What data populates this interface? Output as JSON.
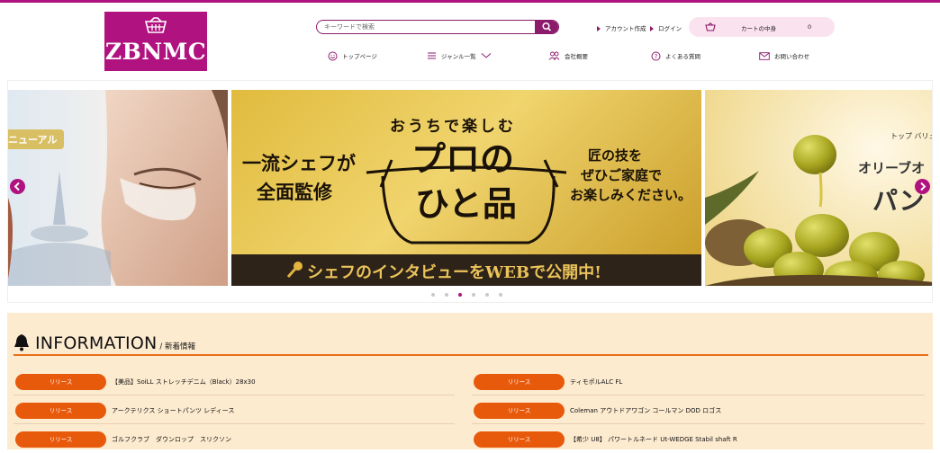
{
  "brand": {
    "name": "ZBNMC"
  },
  "search": {
    "placeholder": "キーワードで検索"
  },
  "header_links": {
    "account": "アカウント作成",
    "login": "ログイン"
  },
  "cart": {
    "label": "カートの中身",
    "count": "0"
  },
  "nav": [
    {
      "label": "トップページ",
      "icon": "smile-icon"
    },
    {
      "label": "ジャンル一覧",
      "icon": "menu-icon"
    },
    {
      "label": "会社概要",
      "icon": "users-icon"
    },
    {
      "label": "よくある質問",
      "icon": "question-icon"
    },
    {
      "label": "お問い合わせ",
      "icon": "mail-icon"
    }
  ],
  "slides": {
    "left": {
      "badge": "ニューアル"
    },
    "center": {
      "line1": "一流シェフが",
      "line2": "全面監修",
      "arc": "おうちで楽しむ",
      "main1": "プロの",
      "main2": "ひと品",
      "right1": "匠の技を",
      "right2": "ぜひご家庭で",
      "right3": "お楽しみください。",
      "footer": "シェフのインタビューをWEBで公開中!"
    },
    "right": {
      "small": "トップ バリュ",
      "mid": "オリーブオ",
      "big": "パン"
    }
  },
  "slider_dots": {
    "count": 6,
    "active_index": 2
  },
  "information": {
    "title": "INFORMATION",
    "subtitle": "/ 新着情報",
    "items_left": [
      {
        "badge": "リリース",
        "text": "【美品】SoiLL ストレッチデニム（Black）28x30"
      },
      {
        "badge": "リリース",
        "text": "アークテリクス ショートパンツ レディース"
      },
      {
        "badge": "リリース",
        "text": "ゴルフクラブ　ダウンロップ　スリクソン"
      }
    ],
    "items_right": [
      {
        "badge": "リリース",
        "text": "ティモポルALC FL"
      },
      {
        "badge": "リリース",
        "text": "Coleman アウトドアワゴン コールマン DOD ロゴス"
      },
      {
        "badge": "リリース",
        "text": "【希少 U8】 パワートルネード Ut-WEDGE Stabil shaft R"
      }
    ]
  },
  "colors": {
    "brand": "#b0127f",
    "accent": "#e85a0b",
    "info_bg": "#fdebd0"
  }
}
